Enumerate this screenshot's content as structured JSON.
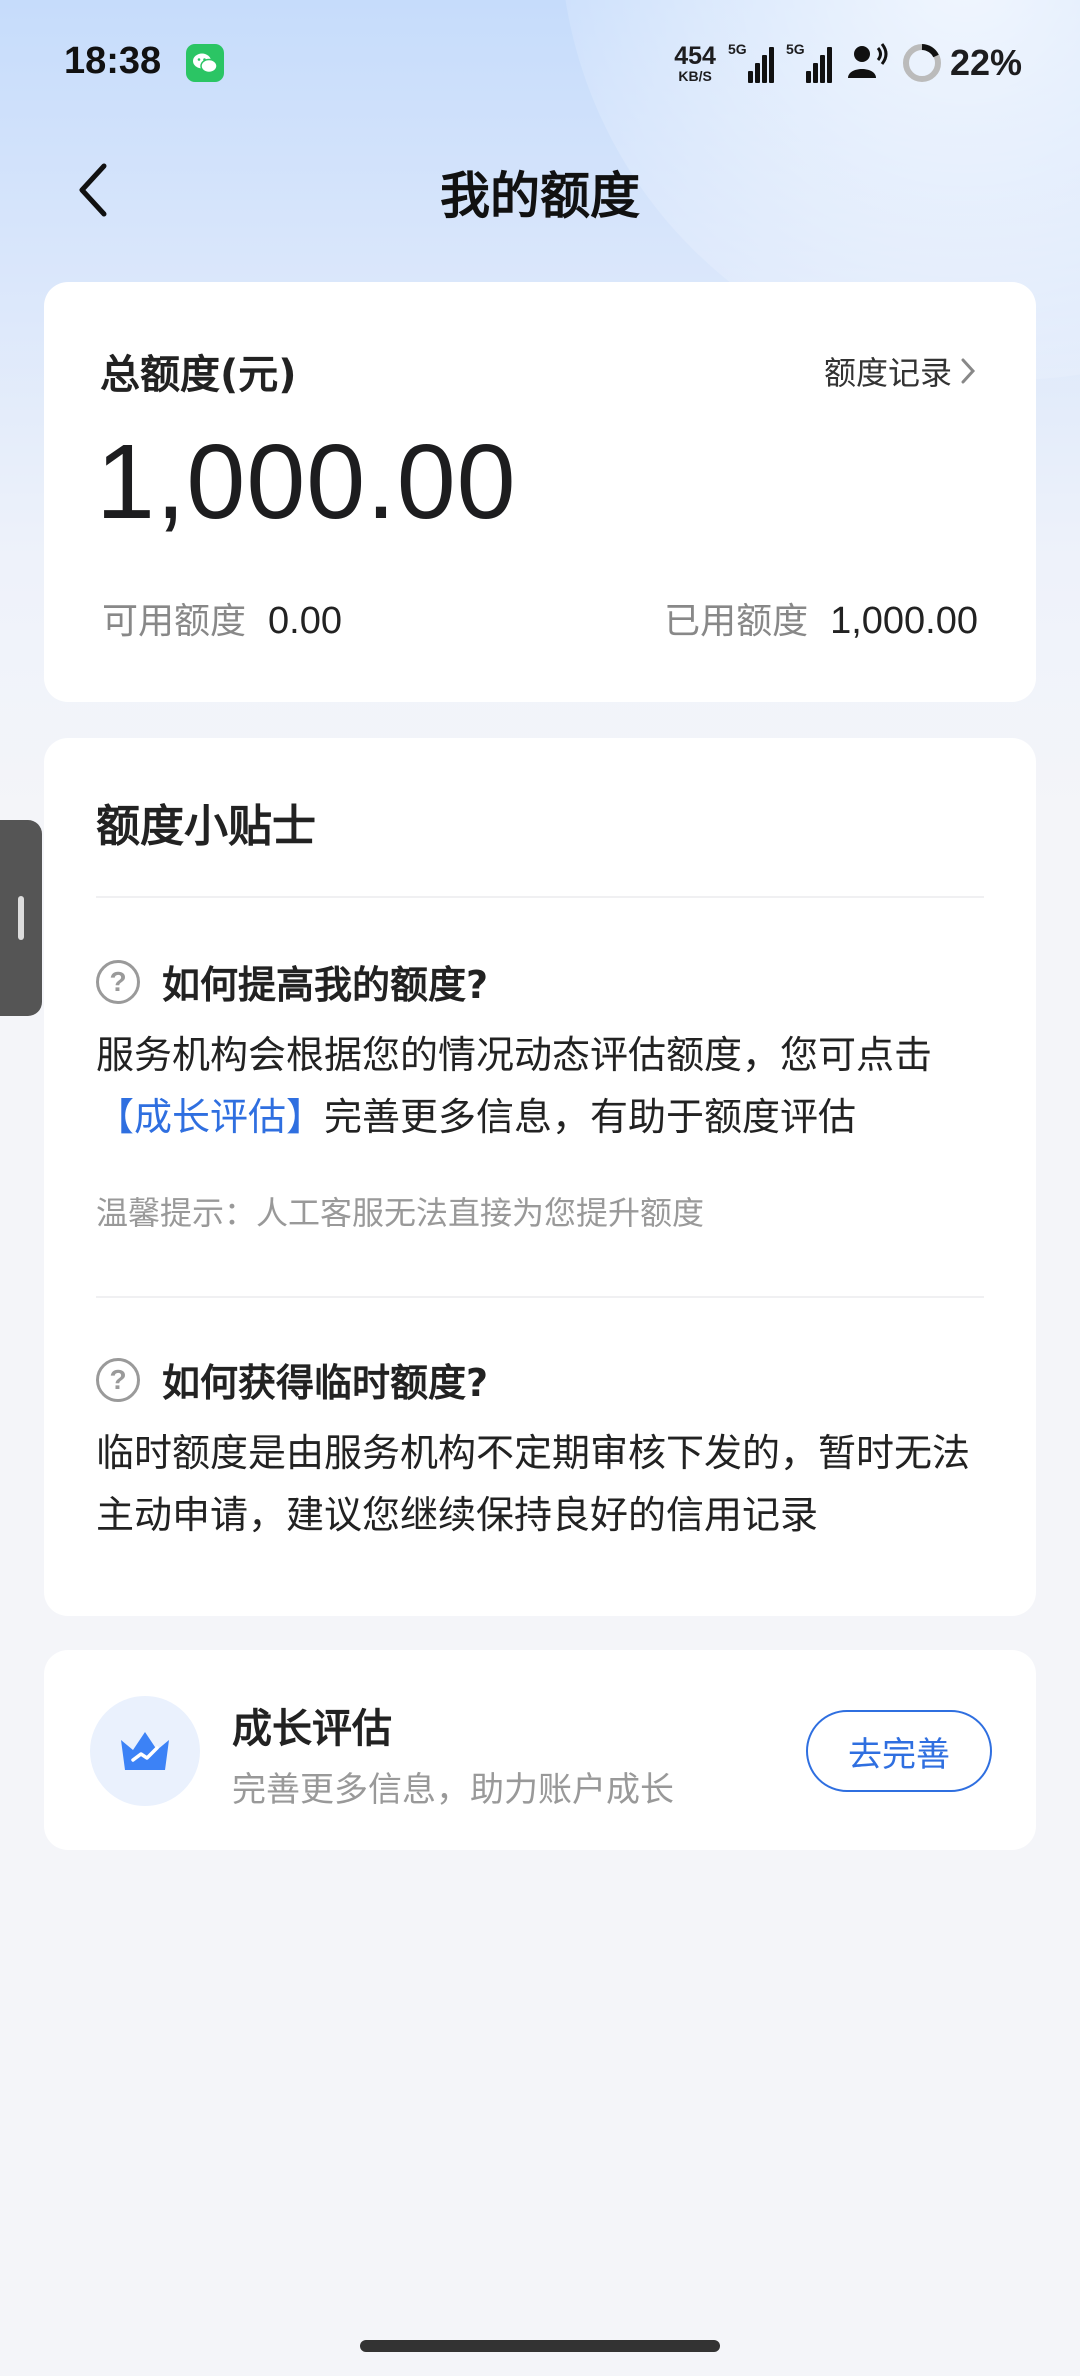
{
  "status_bar": {
    "time": "18:38",
    "net_speed_value": "454",
    "net_speed_unit": "KB/S",
    "sim1_label": "5G",
    "sim2_label": "5G",
    "battery_percent": "22%"
  },
  "header": {
    "title": "我的额度"
  },
  "quota_card": {
    "total_label": "总额度(元)",
    "record_link": "额度记录",
    "total_amount": "1,000.00",
    "available_label": "可用额度",
    "available_value": "0.00",
    "used_label": "已用额度",
    "used_value": "1,000.00"
  },
  "tips_card": {
    "title": "额度小贴士",
    "items": [
      {
        "question": "如何提高我的额度?",
        "answer_prefix": "服务机构会根据您的情况动态评估额度，您可点击",
        "answer_link": "【成长评估】",
        "answer_suffix": "完善更多信息，有助于额度评估",
        "hint": "温馨提示：人工客服无法直接为您提升额度"
      },
      {
        "question": "如何获得临时额度?",
        "answer": "临时额度是由服务机构不定期审核下发的，暂时无法主动申请，建议您继续保持良好的信用记录"
      }
    ]
  },
  "growth_card": {
    "title": "成长评估",
    "subtitle": "完善更多信息，助力账户成长",
    "button_label": "去完善"
  },
  "colors": {
    "accent": "#2f6fe0",
    "background": "#f4f5f9",
    "header_gradient_top": "#c6dcfb"
  },
  "icons": {
    "back": "back-arrow-icon",
    "wechat": "wechat-icon",
    "question": "question-circle-icon",
    "growth": "crown-growth-icon",
    "chevron": "chevron-right-icon"
  }
}
